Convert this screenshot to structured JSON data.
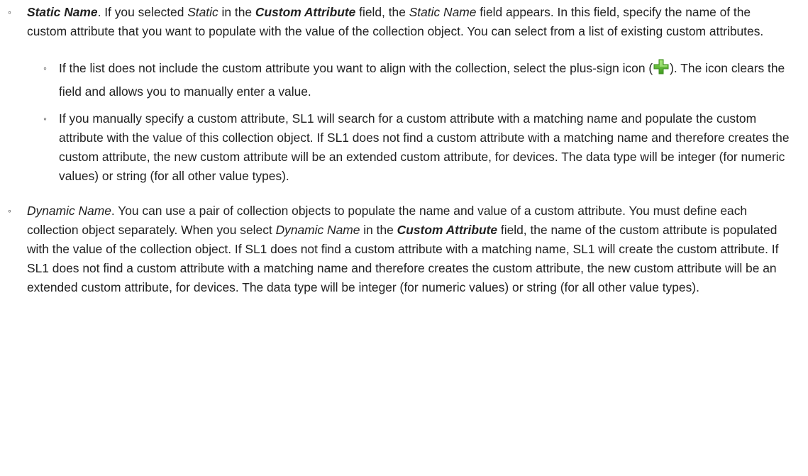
{
  "static_item": {
    "bullet": "◦",
    "term": "Static Name",
    "t1": ". If you selected ",
    "static_word": "Static",
    "t2": " in the ",
    "field_name": "Custom Attribute",
    "t3": " field, the ",
    "static_name_word": "Static Name",
    "t4": " field appears. In this field, specify the name of the custom attribute that you want to populate with the value of the collection object. You can select from a list of existing custom attributes."
  },
  "sub_plus": {
    "bullet": "◦",
    "before_icon": "If the list does not include the custom attribute you want to align with the collection, select the plus-sign icon (",
    "icon": "plus-icon",
    "after_icon": "). The icon clears the field and allows you to manually enter a value."
  },
  "sub_manual": {
    "bullet": "◦",
    "text": "If you manually specify a custom attribute, SL1 will search for a custom attribute with a matching name and populate the custom attribute with the value of this collection object. If SL1 does not find a custom attribute with a matching name and therefore creates the custom attribute, the new custom attribute will be an extended custom attribute, for devices. The data type will be integer (for numeric values) or string (for all other value types)."
  },
  "dynamic_item": {
    "bullet": "◦",
    "term": "Dynamic Name",
    "t1": ". You can use a pair of collection objects to populate the name and value of a custom attribute. You must define each collection object separately. When you select ",
    "dynamic_word": "Dynamic Name",
    "t2": " in the ",
    "field_name": "Custom Attribute",
    "t3": " field, the name of the custom attribute is populated with the value of the collection object. If SL1 does not find a custom attribute with a matching name, SL1 will create the custom attribute. If SL1 does not find a custom attribute with a matching name and therefore creates the custom attribute, the new custom attribute will be an extended custom attribute, for devices. The data type will be integer (for numeric values) or string (for all other value types)."
  },
  "colors": {
    "icon_green": "#5cb531",
    "icon_green_dark": "#3d8a1f",
    "text": "#222222"
  }
}
